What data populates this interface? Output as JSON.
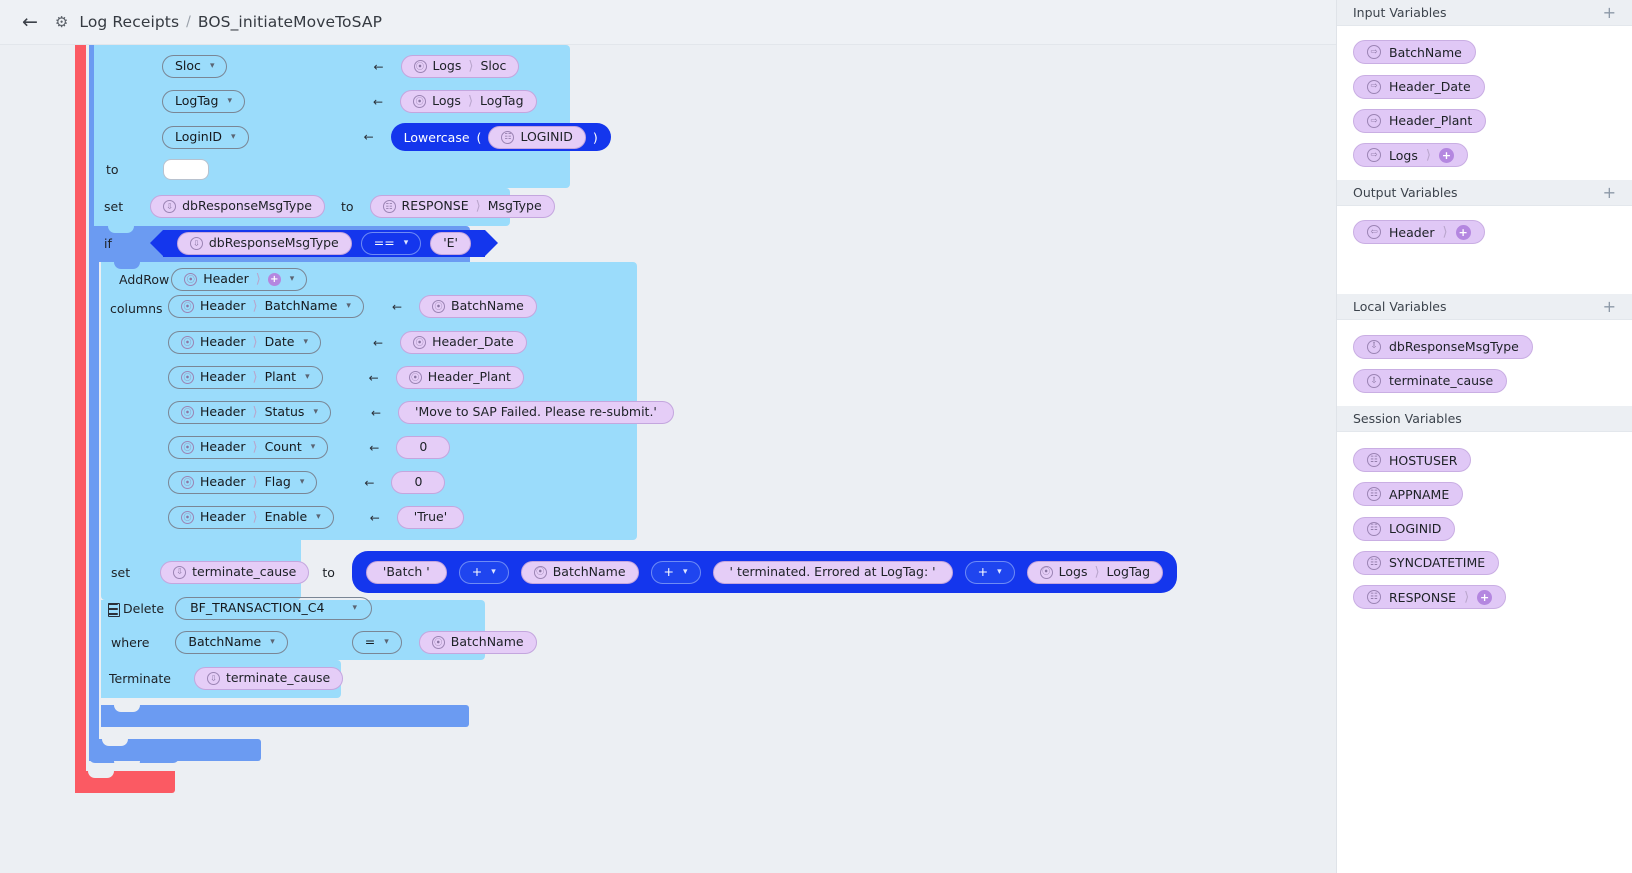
{
  "header": {
    "back_icon": "back-arrow-icon",
    "gear_icon": "gear-icon",
    "app_name": "Log Receipts",
    "separator": "/",
    "flow_name": "BOS_initiateMoveToSAP"
  },
  "canvas": {
    "mapping_rows": [
      {
        "target": "Sloc",
        "arrow": "←",
        "src_obj": "Logs",
        "src_field": "Sloc"
      },
      {
        "target": "LogTag",
        "arrow": "←",
        "src_obj": "Logs",
        "src_field": "LogTag"
      },
      {
        "target": "LoginID",
        "arrow": "←",
        "fn_name": "Lowercase",
        "paren_open": "(",
        "fn_arg": "LOGINID",
        "paren_close": ")"
      }
    ],
    "to_label": "to",
    "to_value": "",
    "set_msgtype": {
      "keyword": "set",
      "variable": "dbResponseMsgType",
      "to_label": "to",
      "value_obj": "RESPONSE",
      "value_field": "MsgType"
    },
    "if_block": {
      "keyword": "if",
      "left": "dbResponseMsgType",
      "operator": "==",
      "right": "'E'"
    },
    "addrow": {
      "keyword": "AddRow",
      "table": "Header",
      "columns_label": "columns",
      "columns": [
        {
          "obj": "Header",
          "field": "BatchName",
          "arrow": "←",
          "value": "BatchName",
          "value_kind": "variable"
        },
        {
          "obj": "Header",
          "field": "Date",
          "arrow": "←",
          "value": "Header_Date",
          "value_kind": "variable"
        },
        {
          "obj": "Header",
          "field": "Plant",
          "arrow": "←",
          "value": "Header_Plant",
          "value_kind": "variable"
        },
        {
          "obj": "Header",
          "field": "Status",
          "arrow": "←",
          "value": "'Move to SAP Failed. Please re-submit.'",
          "value_kind": "literal"
        },
        {
          "obj": "Header",
          "field": "Count",
          "arrow": "←",
          "value": "0",
          "value_kind": "literal"
        },
        {
          "obj": "Header",
          "field": "Flag",
          "arrow": "←",
          "value": "0",
          "value_kind": "literal"
        },
        {
          "obj": "Header",
          "field": "Enable",
          "arrow": "←",
          "value": "'True'",
          "value_kind": "literal"
        }
      ]
    },
    "set_terminate": {
      "keyword": "set",
      "variable": "terminate_cause",
      "to_label": "to",
      "expression": [
        {
          "kind": "literal",
          "text": "'Batch '"
        },
        {
          "kind": "operator",
          "text": "+"
        },
        {
          "kind": "variable",
          "text": "BatchName"
        },
        {
          "kind": "operator",
          "text": "+"
        },
        {
          "kind": "literal",
          "text": "' terminated. Errored at LogTag: '"
        },
        {
          "kind": "operator",
          "text": "+"
        },
        {
          "kind": "field",
          "obj": "Logs",
          "text": "LogTag"
        }
      ]
    },
    "delete_block": {
      "icon": "table-icon",
      "keyword": "Delete",
      "table": "BF_TRANSACTION_C4",
      "where_label": "where",
      "where_field": "BatchName",
      "where_operator": "=",
      "where_value": "BatchName"
    },
    "terminate_block": {
      "keyword": "Terminate",
      "variable": "terminate_cause"
    }
  },
  "sidebar": {
    "sections": [
      {
        "title": "Input Variables",
        "add_icon": "plus-icon",
        "items": [
          {
            "label": "BatchName",
            "icon": "input-arrow-icon",
            "expandable": false
          },
          {
            "label": "Header_Date",
            "icon": "input-arrow-icon",
            "expandable": false
          },
          {
            "label": "Header_Plant",
            "icon": "input-arrow-icon",
            "expandable": false
          },
          {
            "label": "Logs",
            "icon": "input-arrow-icon",
            "expandable": true
          }
        ]
      },
      {
        "title": "Output Variables",
        "add_icon": "plus-icon",
        "items": [
          {
            "label": "Header",
            "icon": "output-arrow-icon",
            "expandable": true
          }
        ]
      },
      {
        "title": "Local Variables",
        "add_icon": "plus-icon",
        "items": [
          {
            "label": "dbResponseMsgType",
            "icon": "down-arrow-icon",
            "expandable": false
          },
          {
            "label": "terminate_cause",
            "icon": "down-arrow-icon",
            "expandable": false
          }
        ]
      },
      {
        "title": "Session Variables",
        "add_icon": "",
        "items": [
          {
            "label": "HOSTUSER",
            "icon": "globe-icon",
            "expandable": false
          },
          {
            "label": "APPNAME",
            "icon": "globe-icon",
            "expandable": false
          },
          {
            "label": "LOGINID",
            "icon": "globe-icon",
            "expandable": false
          },
          {
            "label": "SYNCDATETIME",
            "icon": "globe-icon",
            "expandable": false
          },
          {
            "label": "RESPONSE",
            "icon": "globe-icon",
            "expandable": true
          }
        ]
      }
    ]
  },
  "colors": {
    "canvas_bg": "#eceff3",
    "block_light": "#9bdcfb",
    "block_mid": "#6b9bf2",
    "block_red": "#fb5a63",
    "accent_blue": "#1436ed",
    "chip_purple": "#e5cdf7"
  }
}
